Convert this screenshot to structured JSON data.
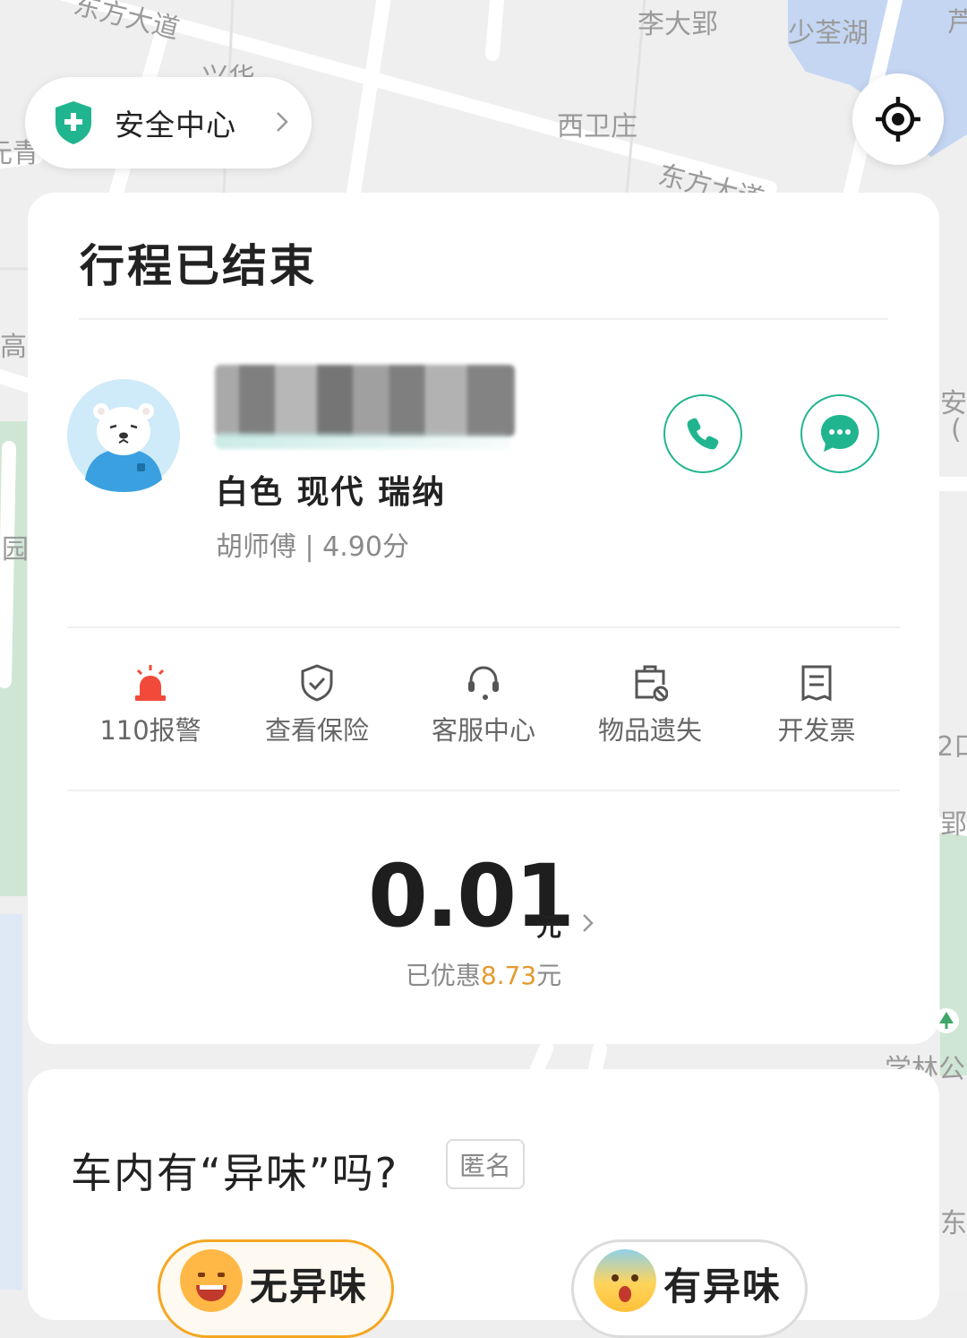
{
  "map": {
    "labels": [
      "东方大道",
      "李大郢",
      "少荃湖",
      "芦",
      "兴华",
      "西卫庄",
      "东方大道",
      "元青",
      "高",
      "安",
      "(",
      "园",
      "2口",
      "郢",
      "学林公",
      "东"
    ]
  },
  "safety_center": {
    "label": "安全中心",
    "icon": "shield-plus-icon"
  },
  "locate": {
    "icon": "locate-crosshair-icon"
  },
  "trip": {
    "status_title": "行程已结束",
    "car_description": "白色 现代 瑞纳",
    "driver_info": "胡师傅 | 4.90分",
    "actions": [
      {
        "label": "110报警",
        "icon": "alarm-siren-icon",
        "color": "#f24a3a"
      },
      {
        "label": "查看保险",
        "icon": "shield-check-icon"
      },
      {
        "label": "客服中心",
        "icon": "headset-icon"
      },
      {
        "label": "物品遗失",
        "icon": "lost-item-icon"
      },
      {
        "label": "开发票",
        "icon": "invoice-icon"
      }
    ],
    "fare": {
      "amount": "0.01",
      "unit": "元"
    },
    "discount": {
      "prefix": "已优惠",
      "amount": "8.73",
      "suffix": "元",
      "color": "#e39a2f"
    }
  },
  "feedback": {
    "question": "车内有“异味”吗?",
    "anonymous_tag": "匿名",
    "options": [
      {
        "label": "无异味",
        "icon": "happy-face-icon"
      },
      {
        "label": "有异味",
        "icon": "shocked-face-icon"
      }
    ]
  },
  "colors": {
    "brand_green": "#21b58f",
    "alarm_red": "#f24a3a",
    "discount_orange": "#e39a2f"
  }
}
